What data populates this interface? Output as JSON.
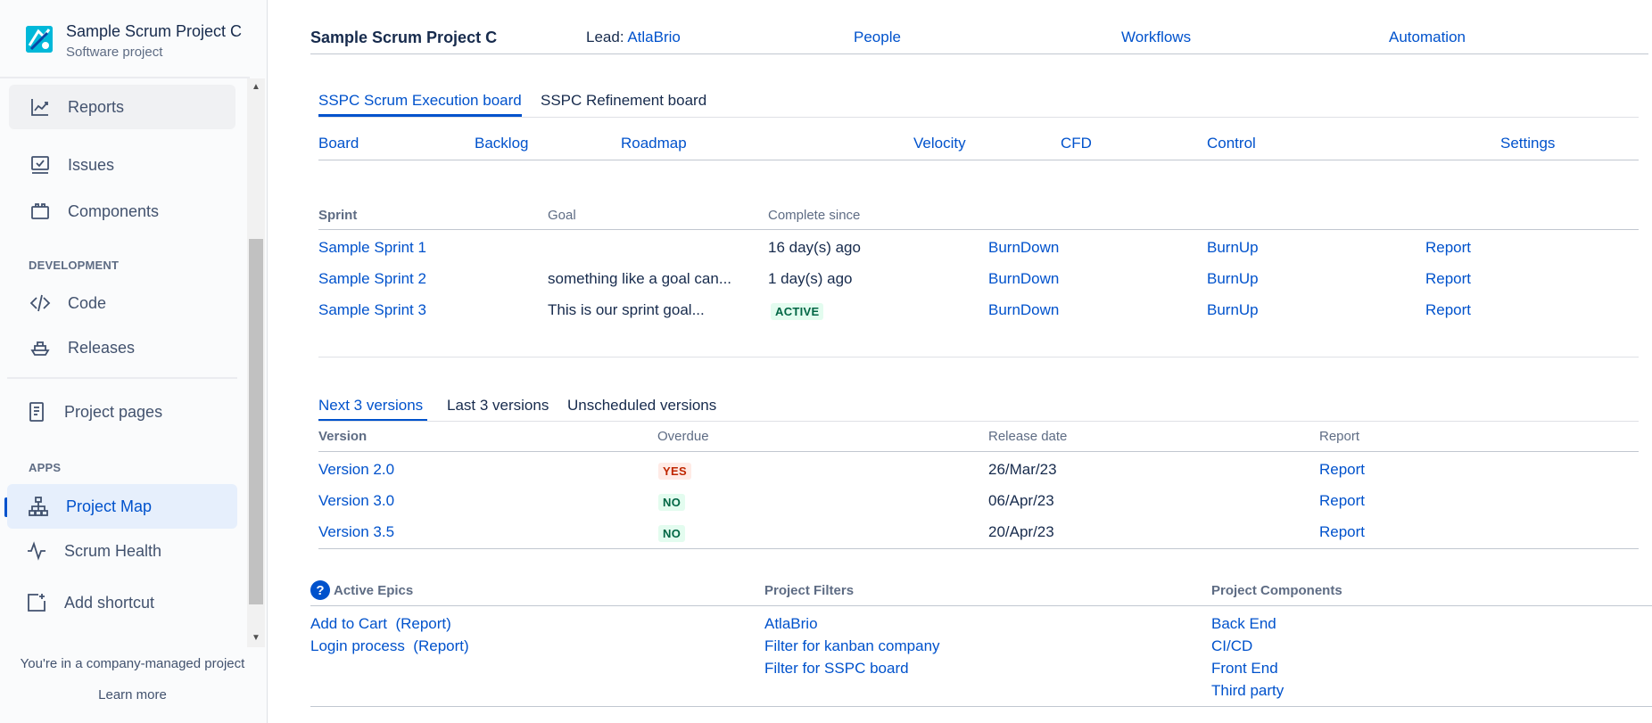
{
  "sidebar": {
    "project_name": "Sample Scrum Project C",
    "project_type": "Software project",
    "items": {
      "reports": "Reports",
      "issues": "Issues",
      "components": "Components",
      "code": "Code",
      "releases": "Releases",
      "project_pages": "Project pages",
      "project_map": "Project Map",
      "scrum_health": "Scrum Health",
      "add_shortcut": "Add shortcut"
    },
    "sections": {
      "development": "DEVELOPMENT",
      "apps": "APPS"
    },
    "footer": {
      "message": "You're in a company-managed project",
      "learn_more": "Learn more"
    }
  },
  "header": {
    "title": "Sample Scrum Project C",
    "lead_label": "Lead: ",
    "lead_name": "AtlaBrio",
    "links": {
      "people": "People",
      "workflows": "Workflows",
      "automation": "Automation"
    }
  },
  "boards": {
    "tabs": [
      "SSPC Scrum Execution board",
      "SSPC Refinement board"
    ],
    "nav": {
      "board": "Board",
      "backlog": "Backlog",
      "roadmap": "Roadmap",
      "velocity": "Velocity",
      "cfd": "CFD",
      "control": "Control",
      "settings": "Settings"
    }
  },
  "sprints": {
    "headers": {
      "sprint": "Sprint",
      "goal": "Goal",
      "complete_since": "Complete since"
    },
    "rows": [
      {
        "name": "Sample Sprint 1",
        "goal": "",
        "since": "16 day(s) ago",
        "burndown": "BurnDown",
        "burnup": "BurnUp",
        "report": "Report"
      },
      {
        "name": "Sample Sprint 2",
        "goal": "something like a goal can...",
        "since": "1 day(s) ago",
        "burndown": "BurnDown",
        "burnup": "BurnUp",
        "report": "Report"
      },
      {
        "name": "Sample Sprint 3",
        "goal": "This is our sprint goal...",
        "since": "ACTIVE",
        "burndown": "BurnDown",
        "burnup": "BurnUp",
        "report": "Report"
      }
    ]
  },
  "versions": {
    "tabs": [
      "Next 3 versions",
      "Last 3 versions",
      "Unscheduled versions"
    ],
    "headers": {
      "version": "Version",
      "overdue": "Overdue",
      "release_date": "Release date",
      "report": "Report"
    },
    "rows": [
      {
        "name": "Version 2.0",
        "overdue": "YES",
        "date": "26/Mar/23",
        "report": "Report"
      },
      {
        "name": "Version 3.0",
        "overdue": "NO",
        "date": "06/Apr/23",
        "report": "Report"
      },
      {
        "name": "Version 3.5",
        "overdue": "NO",
        "date": "20/Apr/23",
        "report": "Report"
      }
    ]
  },
  "bottom": {
    "epics_title": "Active Epics",
    "help_glyph": "?",
    "epics": [
      {
        "name": "Add to Cart",
        "report": "(Report)"
      },
      {
        "name": "Login process",
        "report": "(Report)"
      }
    ],
    "filters_title": "Project Filters",
    "filters": [
      "AtlaBrio",
      "Filter for kanban company",
      "Filter for SSPC board"
    ],
    "components_title": "Project Components",
    "components": [
      "Back End",
      "CI/CD",
      "Front End",
      "Third party"
    ]
  },
  "colors": {
    "link": "#0052cc",
    "text": "#172b4d",
    "muted": "#5e6c84",
    "active_bg": "#e6effc"
  }
}
